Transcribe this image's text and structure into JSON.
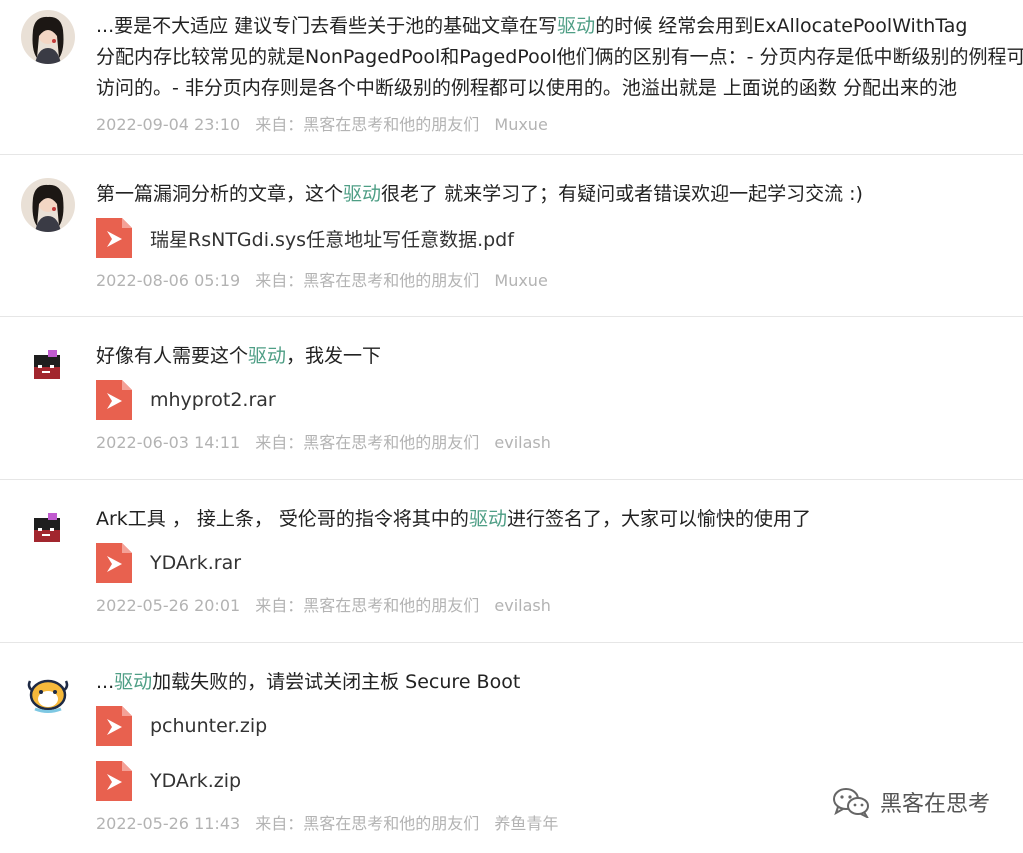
{
  "posts": [
    {
      "lines": [
        [
          "...要是不大适应 建议专门去看些关于池的基础文章在写",
          "驱动",
          "的时候 经常会用到ExAllocatePoolWithTag"
        ],
        [
          "分配内存比较常见的就是NonPagedPool和PagedPool他们俩的区别有一点：- 分页内存是低中断级别的例程可以",
          "",
          ""
        ],
        [
          "访问的。- 非分页内存则是各个中断级别的例程都可以使用的。池溢出就是 上面说的函数 分配出来的池",
          "",
          ""
        ]
      ],
      "files": [],
      "time": "2022-09-04 23:10",
      "source": "来自：黑客在思考和他的朋友们",
      "author": "Muxue"
    },
    {
      "lines": [
        [
          "第一篇漏洞分析的文章，这个",
          "驱动",
          "很老了 就来学习了；有疑问或者错误欢迎一起学习交流 :)"
        ]
      ],
      "files": [
        "瑞星RsNTGdi.sys任意地址写任意数据.pdf"
      ],
      "time": "2022-08-06 05:19",
      "source": "来自：黑客在思考和他的朋友们",
      "author": "Muxue"
    },
    {
      "lines": [
        [
          "好像有人需要这个",
          "驱动",
          "，我发一下"
        ]
      ],
      "files": [
        "mhyprot2.rar"
      ],
      "time": "2022-06-03 14:11",
      "source": "来自：黑客在思考和他的朋友们",
      "author": "evilash"
    },
    {
      "lines": [
        [
          "Ark工具 ， 接上条，  受伦哥的指令将其中的",
          "驱动",
          "进行签名了，大家可以愉快的使用了"
        ]
      ],
      "files": [
        "YDArk.rar"
      ],
      "time": "2022-05-26 20:01",
      "source": "来自：黑客在思考和他的朋友们",
      "author": "evilash"
    },
    {
      "lines": [
        [
          "...",
          "驱动",
          "加载失败的，请尝试关闭主板 Secure Boot"
        ]
      ],
      "files": [
        "pchunter.zip",
        "YDArk.zip"
      ],
      "time": "2022-05-26 11:43",
      "source": "来自：黑客在思考和他的朋友们",
      "author": "养鱼青年"
    }
  ],
  "watermark": {
    "text": "黑客在思考",
    "icon": "wechat-icon"
  },
  "colors": {
    "highlight": "#4e9e85",
    "meta": "#b3b3b3",
    "file_icon": "#e8614f",
    "divider": "#e6e6e6"
  }
}
